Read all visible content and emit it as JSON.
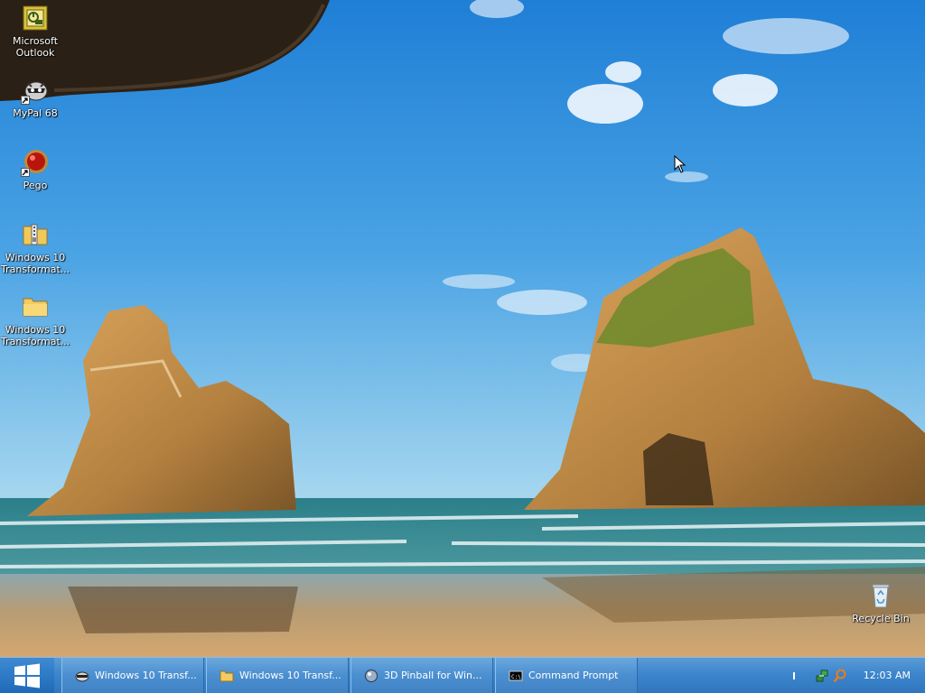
{
  "desktop": {
    "icons": [
      {
        "label": "Microsoft Outlook",
        "icon": "outlook-icon"
      },
      {
        "label": "MyPal 68",
        "icon": "mypal-raccoon-icon"
      },
      {
        "label": "Pego",
        "icon": "pego-red-ball-icon"
      },
      {
        "label": "Windows 10 Transformat...",
        "icon": "zip-folder-icon"
      },
      {
        "label": "Windows 10 Transformat...",
        "icon": "folder-icon"
      },
      {
        "label": "Recycle Bin",
        "icon": "recycle-bin-icon"
      }
    ]
  },
  "taskbar": {
    "start_icon": "windows-logo-icon",
    "buttons": [
      {
        "label": "Windows 10 Transf...",
        "icon": "mypal-raccoon-icon"
      },
      {
        "label": "Windows 10 Transf...",
        "icon": "folder-icon"
      },
      {
        "label": "3D Pinball for Win...",
        "icon": "pinball-icon"
      },
      {
        "label": "Command Prompt",
        "icon": "command-prompt-icon"
      }
    ],
    "tray": {
      "icons": [
        "network-icon",
        "search-icon"
      ],
      "clock": "12:03 AM"
    }
  },
  "colors": {
    "taskbar": "#3d86cc",
    "sky": "#4a9ee0",
    "sand": "#c8a06a"
  }
}
